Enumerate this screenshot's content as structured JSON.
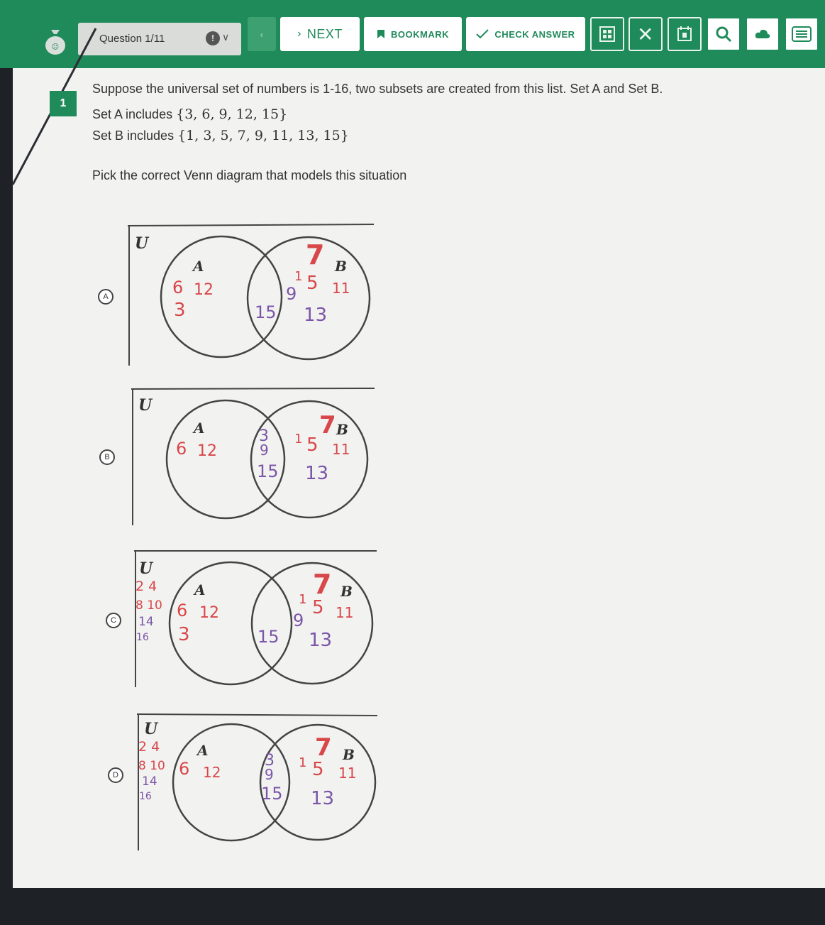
{
  "toolbar": {
    "question_label": "Question 1/11",
    "next_label": "NEXT",
    "bookmark_label": "BOOKMARK",
    "check_label": "CHECK ANSWER",
    "accent": "#1f8a5a"
  },
  "question": {
    "number": "1",
    "line1": "Suppose the universal set of numbers is 1-16, two subsets are created from this list. Set A and Set B.",
    "setA_prefix": "Set A includes",
    "setA_math": "{3, 6, 9, 12, 15}",
    "setB_prefix": "Set B includes",
    "setB_math": "{1, 3, 5, 7, 9, 11, 13, 15}",
    "prompt": "Pick the correct Venn diagram that models this situation"
  },
  "options": [
    {
      "letter": "A",
      "universe": "U",
      "setA": "A",
      "setB": "B",
      "a_only": [
        "6",
        "12",
        "3"
      ],
      "both": [
        "15"
      ],
      "b_only": [
        "7",
        "1",
        "5",
        "11",
        "9",
        "13"
      ],
      "outside": []
    },
    {
      "letter": "B",
      "universe": "U",
      "setA": "A",
      "setB": "B",
      "a_only": [
        "6",
        "12"
      ],
      "both": [
        "3",
        "9",
        "15"
      ],
      "b_only": [
        "7",
        "1",
        "5",
        "11",
        "13"
      ],
      "outside": []
    },
    {
      "letter": "C",
      "universe": "U",
      "setA": "A",
      "setB": "B",
      "a_only": [
        "6",
        "12",
        "3"
      ],
      "both": [
        "15"
      ],
      "b_only": [
        "7",
        "1",
        "5",
        "11",
        "9",
        "13"
      ],
      "outside": [
        "2 4",
        "8 10",
        "14",
        "16"
      ]
    },
    {
      "letter": "D",
      "universe": "U",
      "setA": "A",
      "setB": "B",
      "a_only": [
        "6",
        "12"
      ],
      "both": [
        "3",
        "9",
        "15"
      ],
      "b_only": [
        "7",
        "1",
        "5",
        "11",
        "13"
      ],
      "outside": [
        "2 4",
        "8 10",
        "14",
        "16"
      ]
    }
  ]
}
